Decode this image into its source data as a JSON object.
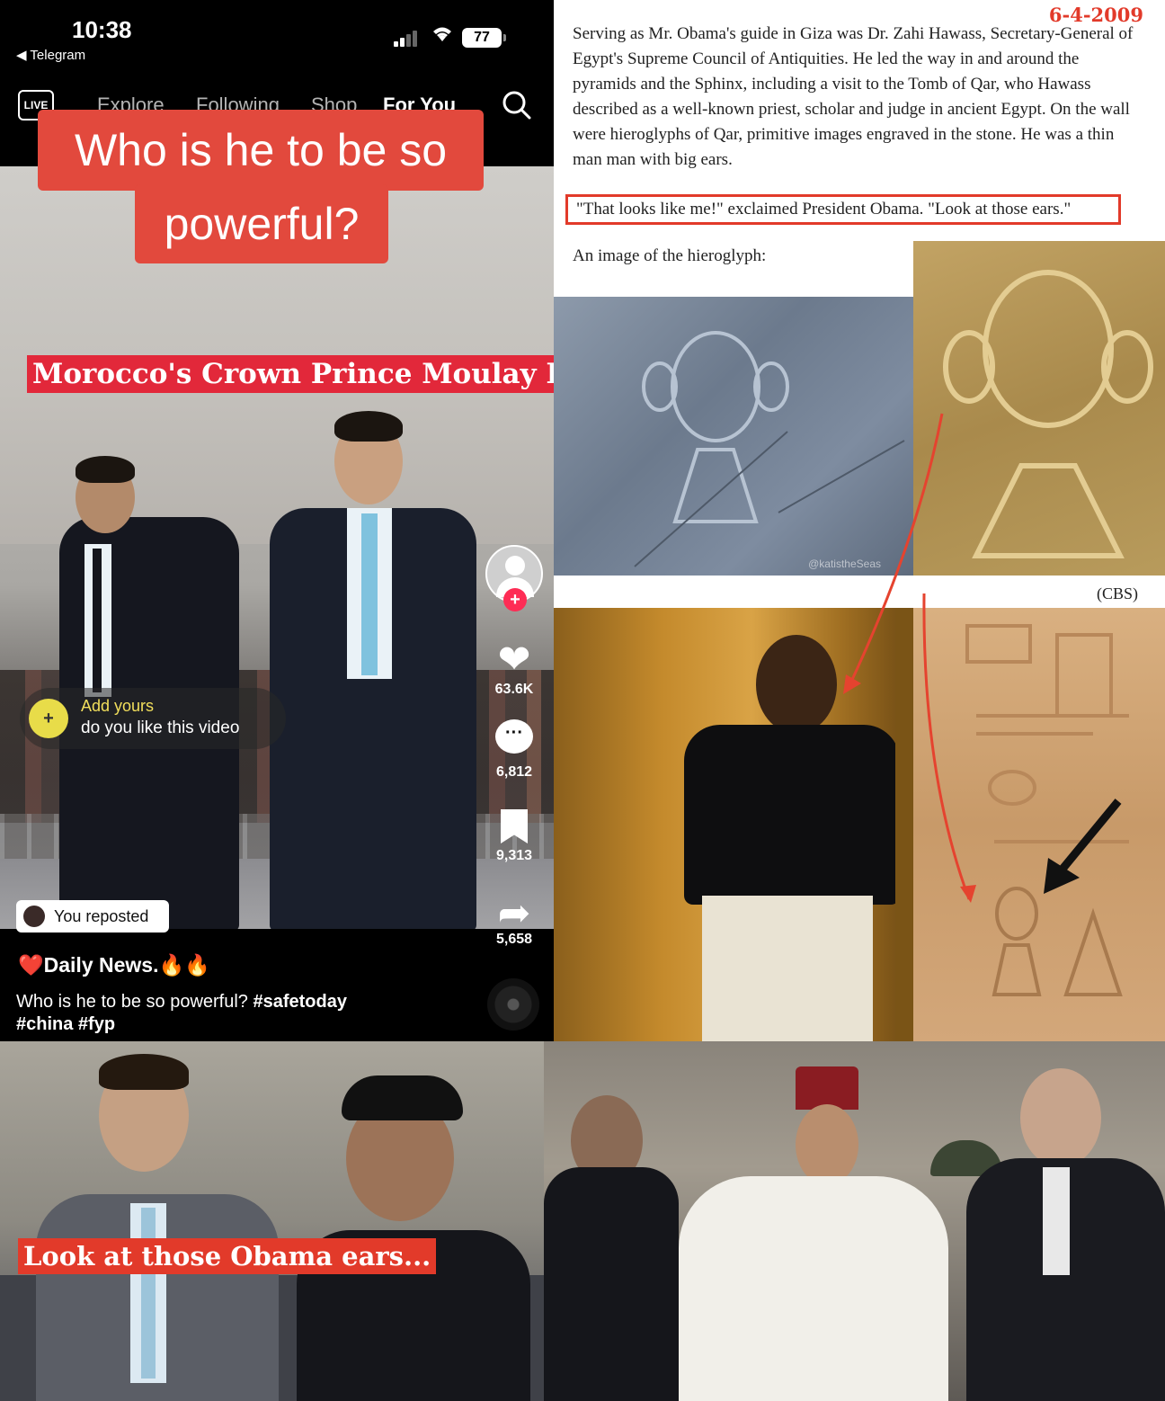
{
  "status_bar": {
    "time": "10:38",
    "back_app": "◀ Telegram",
    "battery": "77"
  },
  "tiktok": {
    "nav": {
      "live_label": "LIVE",
      "tabs": [
        "Explore",
        "Following",
        "Shop",
        "For You"
      ],
      "active_tab": "For You"
    },
    "caption_line1": "Who is he to be so",
    "caption_line2": "powerful?",
    "prince_label": "Morocco's Crown Prince Moulay El Hassan",
    "add_yours": {
      "title": "Add yours",
      "subtitle": "do you like this video"
    },
    "rail": {
      "likes": "63.6K",
      "comments": "6,812",
      "bookmarks": "9,313",
      "shares": "5,658"
    },
    "reposted": "You reposted",
    "author": "Daily News.",
    "author_emoji": "❤️",
    "author_fire": "🔥🔥",
    "description": "Who is he to be so powerful?",
    "hashtags": [
      "#safetoday",
      "#china",
      "#fyp"
    ]
  },
  "article": {
    "date": "6-4-2009",
    "paragraph": "Serving as Mr. Obama's guide in Giza was Dr. Zahi Hawass, Secretary-General of Egypt's Supreme Council of Antiquities. He led the way in and around the pyramids and the Sphinx, including a visit to the Tomb of Qar, who Hawass described as a well-known priest, scholar and judge in ancient Egypt. On the wall were hieroglyphs of Qar, primitive images engraved in the stone. He was a thin man man with big ears.",
    "quote": "\"That looks like me!\" exclaimed President Obama. \"Look at those ears.\"",
    "image_intro": "An image of the hieroglyph:",
    "credit": "(CBS)",
    "watermark": "@katistheSeas"
  },
  "bottom": {
    "ears_label": "Look at those Obama ears..."
  },
  "colors": {
    "accent_red": "#e2493d",
    "tiktok_red": "#fe2c55",
    "add_yours_yellow": "#e8dc49"
  }
}
